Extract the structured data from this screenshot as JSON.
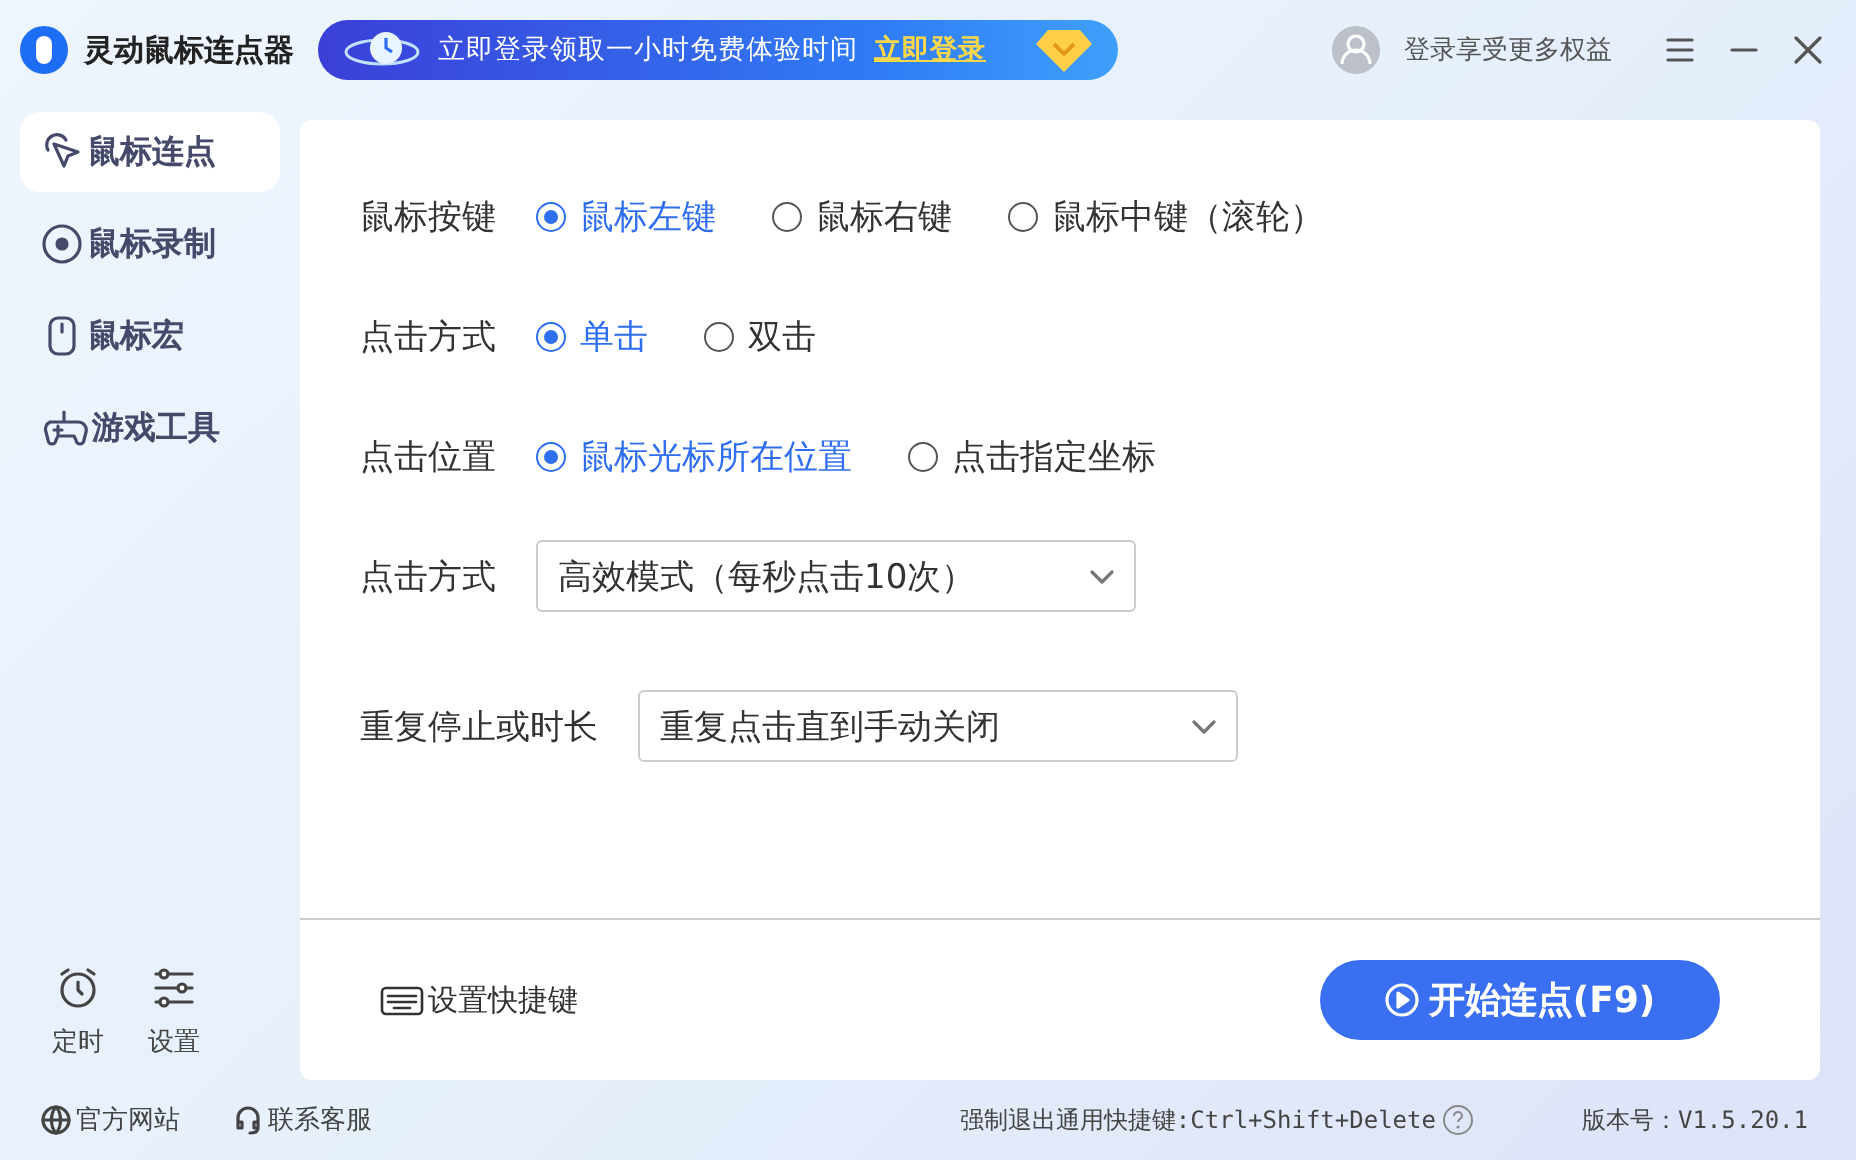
{
  "header": {
    "app_name": "灵动鼠标连点器",
    "promo_text": "立即登录领取一小时免费体验时间",
    "promo_link": "立即登录",
    "login_text": "登录享受更多权益"
  },
  "sidebar": {
    "items": [
      {
        "label": "鼠标连点",
        "kind": "cursor",
        "selected": true
      },
      {
        "label": "鼠标录制",
        "kind": "record",
        "selected": false
      },
      {
        "label": "鼠标宏",
        "kind": "mouse",
        "selected": false
      },
      {
        "label": "游戏工具",
        "kind": "gamepad",
        "selected": false
      }
    ],
    "bottom": [
      {
        "label": "定时",
        "kind": "clock"
      },
      {
        "label": "设置",
        "kind": "sliders"
      }
    ]
  },
  "form": {
    "rows": [
      {
        "kind": "radio",
        "label": "鼠标按键",
        "options": [
          {
            "label": "鼠标左键",
            "selected": true
          },
          {
            "label": "鼠标右键",
            "selected": false
          },
          {
            "label": "鼠标中键（滚轮）",
            "selected": false
          }
        ]
      },
      {
        "kind": "radio",
        "label": "点击方式",
        "options": [
          {
            "label": "单击",
            "selected": true
          },
          {
            "label": "双击",
            "selected": false
          }
        ]
      },
      {
        "kind": "radio",
        "label": "点击位置",
        "options": [
          {
            "label": "鼠标光标所在位置",
            "selected": true
          },
          {
            "label": "点击指定坐标",
            "selected": false
          }
        ]
      },
      {
        "kind": "select",
        "label": "点击方式",
        "value": "高效模式（每秒点击10次）"
      },
      {
        "kind": "select",
        "label": "重复停止或时长",
        "value": "重复点击直到手动关闭"
      }
    ]
  },
  "hotkey_link": "设置快捷键",
  "start_button": "开始连点(F9)",
  "footer": {
    "links": [
      {
        "label": "官方网站",
        "kind": "globe"
      },
      {
        "label": "联系客服",
        "kind": "headset"
      }
    ],
    "shortcut_note": "强制退出通用快捷键:Ctrl+Shift+Delete",
    "version": "版本号：V1.5.20.1"
  }
}
